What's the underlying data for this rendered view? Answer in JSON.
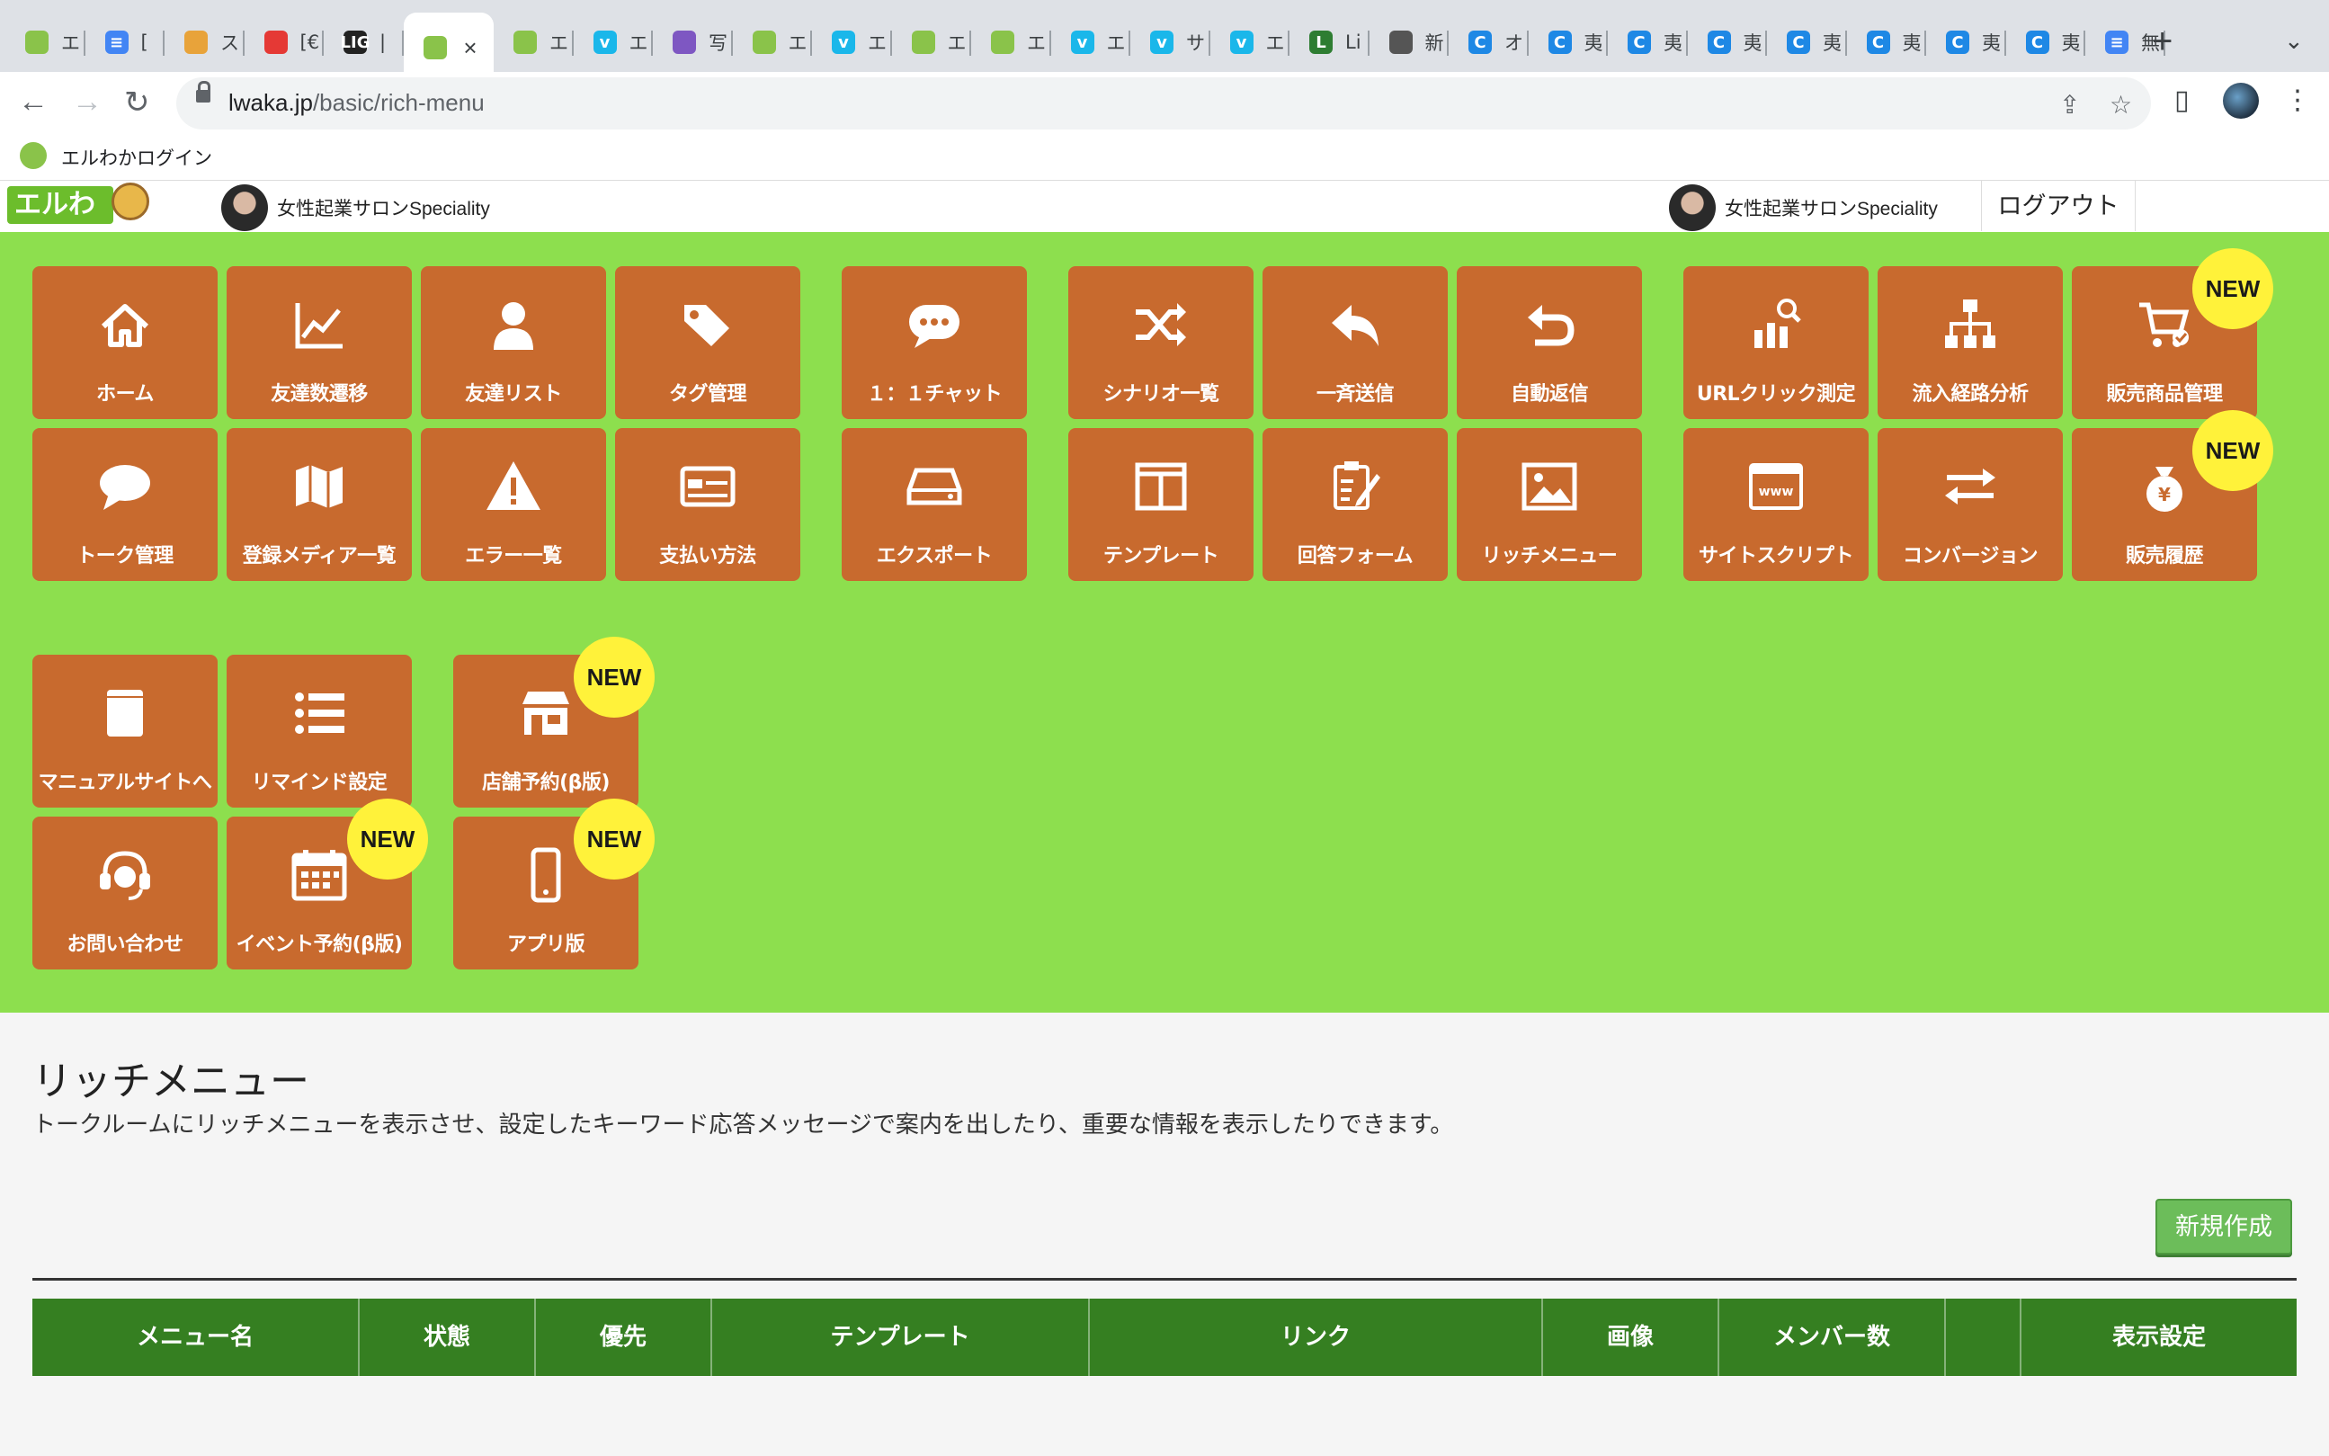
{
  "browser": {
    "tabs": [
      {
        "title": "エ",
        "fav_color": "#8ac34a",
        "fav": ""
      },
      {
        "title": "[",
        "fav_color": "#4285f4",
        "fav": "≡"
      },
      {
        "title": "ス",
        "fav_color": "#e8a33a",
        "fav": ""
      },
      {
        "title": "[€",
        "fav_color": "#e53935",
        "fav": ""
      },
      {
        "title": "|",
        "fav_color": "#222222",
        "fav": "LIG"
      },
      {
        "title": "",
        "fav_color": "#8ac34a",
        "fav": "",
        "active": true
      },
      {
        "title": "エ",
        "fav_color": "#8ac34a",
        "fav": ""
      },
      {
        "title": "エ",
        "fav_color": "#1ab7ea",
        "fav": "v"
      },
      {
        "title": "写",
        "fav_color": "#7e57c2",
        "fav": ""
      },
      {
        "title": "エ",
        "fav_color": "#8ac34a",
        "fav": ""
      },
      {
        "title": "エ",
        "fav_color": "#1ab7ea",
        "fav": "v"
      },
      {
        "title": "エ",
        "fav_color": "#8ac34a",
        "fav": ""
      },
      {
        "title": "エ",
        "fav_color": "#8ac34a",
        "fav": ""
      },
      {
        "title": "エ",
        "fav_color": "#1ab7ea",
        "fav": "v"
      },
      {
        "title": "サ",
        "fav_color": "#1ab7ea",
        "fav": "v"
      },
      {
        "title": "エ",
        "fav_color": "#1ab7ea",
        "fav": "v"
      },
      {
        "title": "Li",
        "fav_color": "#2e7d32",
        "fav": "L"
      },
      {
        "title": "新",
        "fav_color": "#555555",
        "fav": ""
      },
      {
        "title": "オ",
        "fav_color": "#1e88e5",
        "fav": "C"
      },
      {
        "title": "夷",
        "fav_color": "#1e88e5",
        "fav": "C"
      },
      {
        "title": "夷",
        "fav_color": "#1e88e5",
        "fav": "C"
      },
      {
        "title": "夷",
        "fav_color": "#1e88e5",
        "fav": "C"
      },
      {
        "title": "夷",
        "fav_color": "#1e88e5",
        "fav": "C"
      },
      {
        "title": "夷",
        "fav_color": "#1e88e5",
        "fav": "C"
      },
      {
        "title": "夷",
        "fav_color": "#1e88e5",
        "fav": "C"
      },
      {
        "title": "夷",
        "fav_color": "#1e88e5",
        "fav": "C"
      },
      {
        "title": "無",
        "fav_color": "#4285f4",
        "fav": "≡"
      }
    ],
    "url_host": "lwaka.jp",
    "url_path": "/basic/rich-menu",
    "bookmark_label": "エルわかログイン"
  },
  "header": {
    "logo_text": "エルわか",
    "account_left": "女性起業サロンSpeciality",
    "account_right": "女性起業サロンSpeciality",
    "logout_label": "ログアウト"
  },
  "menu": {
    "new_badge": "NEW",
    "items": [
      {
        "label": "ホーム",
        "icon": "home-icon",
        "new": false
      },
      {
        "label": "友達数遷移",
        "icon": "line-chart-icon",
        "new": false
      },
      {
        "label": "友達リスト",
        "icon": "user-icon",
        "new": false
      },
      {
        "label": "タグ管理",
        "icon": "tags-icon",
        "new": false
      },
      {
        "label": "１：１チャット",
        "icon": "chat-bubble-icon",
        "new": false
      },
      {
        "label": "シナリオ一覧",
        "icon": "shuffle-icon",
        "new": false
      },
      {
        "label": "一斉送信",
        "icon": "reply-icon",
        "new": false
      },
      {
        "label": "自動返信",
        "icon": "undo-icon",
        "new": false
      },
      {
        "label": "URLクリック測定",
        "icon": "analytics-icon",
        "new": false
      },
      {
        "label": "流入経路分析",
        "icon": "sitemap-icon",
        "new": false
      },
      {
        "label": "販売商品管理",
        "icon": "cart-icon",
        "new": true
      },
      {
        "label": "トーク管理",
        "icon": "comment-icon",
        "new": false
      },
      {
        "label": "登録メディア一覧",
        "icon": "map-icon",
        "new": false
      },
      {
        "label": "エラー一覧",
        "icon": "warning-icon",
        "new": false
      },
      {
        "label": "支払い方法",
        "icon": "credit-card-icon",
        "new": false
      },
      {
        "label": "エクスポート",
        "icon": "hdd-icon",
        "new": false
      },
      {
        "label": "テンプレート",
        "icon": "columns-icon",
        "new": false
      },
      {
        "label": "回答フォーム",
        "icon": "clipboard-icon",
        "new": false
      },
      {
        "label": "リッチメニュー",
        "icon": "image-icon",
        "new": false
      },
      {
        "label": "サイトスクリプト",
        "icon": "www-icon",
        "new": false
      },
      {
        "label": "コンバージョン",
        "icon": "exchange-icon",
        "new": false
      },
      {
        "label": "販売履歴",
        "icon": "money-bag-icon",
        "new": true
      },
      {
        "label": "マニュアルサイトへ",
        "icon": "book-icon",
        "new": false
      },
      {
        "label": "リマインド設定",
        "icon": "list-icon",
        "new": false
      },
      {
        "label": "店舗予約(β版)",
        "icon": "store-icon",
        "new": true
      },
      {
        "label": "お問い合わせ",
        "icon": "headset-icon",
        "new": false
      },
      {
        "label": "イベント予約(β版)",
        "icon": "calendar-icon",
        "new": true
      },
      {
        "label": "アプリ版",
        "icon": "mobile-icon",
        "new": true
      }
    ]
  },
  "content": {
    "title": "リッチメニュー",
    "description": "トークルームにリッチメニューを表示させ、設定したキーワード応答メッセージで案内を出したり、重要な情報を表示したりできます。",
    "create_button": "新規作成",
    "table_headers": [
      "メニュー名",
      "状態",
      "優先",
      "テンプレート",
      "リンク",
      "画像",
      "メンバー数",
      "",
      "表示設定"
    ]
  },
  "colors": {
    "panel": "#8ddf4e",
    "button": "#c86a2e",
    "badge": "#fff23a",
    "table_header": "#357f21"
  }
}
